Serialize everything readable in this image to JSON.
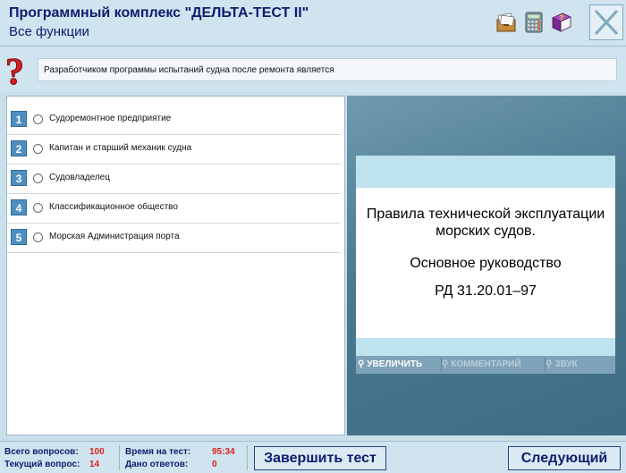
{
  "header": {
    "title": "Программный комплекс \"ДЕЛЬТА-ТЕСТ II\"",
    "subtitle": "Все функции"
  },
  "question": {
    "text": "Разработчиком программы испытаний судна после ремонта является"
  },
  "answers": [
    {
      "num": "1",
      "label": "Судоремонтное предприятие"
    },
    {
      "num": "2",
      "label": "Капитан и старший механик судна"
    },
    {
      "num": "3",
      "label": "Судовладелец"
    },
    {
      "num": "4",
      "label": "Классификационное общество"
    },
    {
      "num": "5",
      "label": "Морская Администрация порта"
    }
  ],
  "document_image": {
    "line1": "Правила технической эксплуатации морских судов.",
    "line2": "Основное руководство",
    "line3": "РД 31.20.01–97"
  },
  "image_toolbar": {
    "zoom": "УВЕЛИЧИТЬ",
    "comments": "КОММЕНТАРИЙ",
    "sound": "ЗВУК"
  },
  "status": {
    "total_label": "Всего вопросов:",
    "total_value": "100",
    "current_label": "Текущий вопрос:",
    "current_value": "14",
    "time_label": "Время на тест:",
    "time_value": "95:34",
    "answered_label": "Дано ответов:",
    "answered_value": "0"
  },
  "buttons": {
    "finish": "Завершить тест",
    "next": "Следующий"
  },
  "icons": {
    "cardfile": "card-file-icon",
    "calculator": "calculator-icon",
    "help": "help-book-icon",
    "close": "close-icon",
    "question": "question-mark-icon",
    "magnifier": "magnifier-icon"
  },
  "colors": {
    "accent_text": "#0c1d6e",
    "value_red": "#e02020",
    "panel_bg": "#cfe4ee"
  }
}
